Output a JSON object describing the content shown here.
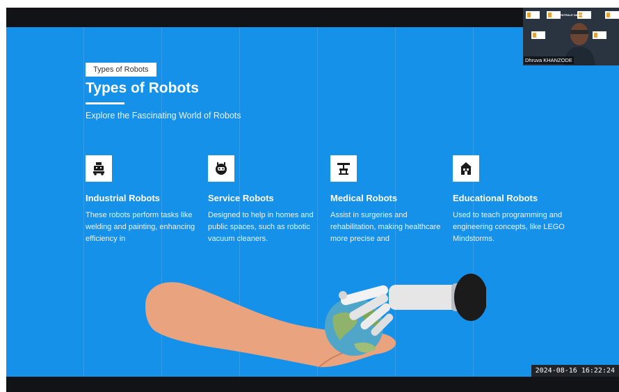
{
  "slide": {
    "tag_label": "Types of Robots",
    "title": "Types of Robots",
    "subtitle": "Explore the Fascinating World of Robots",
    "cards": [
      {
        "icon": "industrial-robot-icon",
        "title": "Industrial Robots",
        "description": "These robots perform tasks like welding and painting, enhancing efficiency in"
      },
      {
        "icon": "service-robot-icon",
        "title": "Service Robots",
        "description": "Designed to help in homes and public spaces, such as robotic vacuum cleaners."
      },
      {
        "icon": "medical-robot-icon",
        "title": "Medical Robots",
        "description": "Assist in surgeries and rehabilitation, making healthcare more precise and"
      },
      {
        "icon": "educational-robot-icon",
        "title": "Educational Robots",
        "description": "Used to teach programming and engineering concepts, like LEGO Mindstorms."
      }
    ],
    "background_color": "#1591ea"
  },
  "webcam": {
    "participant_name": "Dhruva KHANZODE",
    "banner_text": "CENTRALE NANTES"
  },
  "timestamp": "2024-08-16 16:22:24"
}
